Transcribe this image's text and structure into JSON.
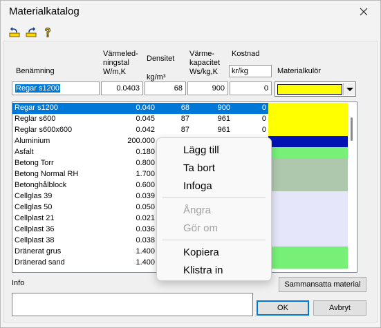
{
  "window": {
    "title": "Materialkatalog"
  },
  "toolbar": {
    "icons": [
      "undo-icon",
      "redo-icon",
      "help-icon"
    ]
  },
  "headers": {
    "name": "Benämning",
    "conductivity": [
      "Värmeled-",
      "ningstal",
      "W/m,K"
    ],
    "density": [
      "Densitet",
      "kg/m³"
    ],
    "heatcap": [
      "Värme-",
      "kapacitet",
      "Ws/kg,K"
    ],
    "cost": [
      "Kostnad",
      "kr/kg"
    ],
    "color": "Materialkulör"
  },
  "edit": {
    "name": "Regar s1200",
    "conductivity": "0.0403",
    "density": "68",
    "heatcap": "900",
    "cost": "0",
    "color": "#ffff00"
  },
  "materials": [
    {
      "name": "Regar s1200",
      "v1": "0.040",
      "v2": "68",
      "v3": "900",
      "v4": "0",
      "color": "#ffff00"
    },
    {
      "name": "Reglar s600",
      "v1": "0.045",
      "v2": "87",
      "v3": "961",
      "v4": "0",
      "color": "#ffff00"
    },
    {
      "name": "Reglar s600x600",
      "v1": "0.042",
      "v2": "87",
      "v3": "961",
      "v4": "0",
      "color": "#ffff00"
    },
    {
      "name": "Aluminium",
      "v1": "200.000",
      "v2": "",
      "v3": "",
      "v4": "",
      "color": "#0014b4"
    },
    {
      "name": "Asfalt",
      "v1": "0.180",
      "v2": "",
      "v3": "",
      "v4": "",
      "color": "#78f078"
    },
    {
      "name": "Betong Torr",
      "v1": "0.800",
      "v2": "",
      "v3": "",
      "v4": "",
      "color": "#aec8ae"
    },
    {
      "name": "Betong Normal RH",
      "v1": "1.700",
      "v2": "",
      "v3": "",
      "v4": "",
      "color": "#aec8ae"
    },
    {
      "name": "Betonghålblock",
      "v1": "0.600",
      "v2": "",
      "v3": "",
      "v4": "",
      "color": "#aec8ae"
    },
    {
      "name": "Cellglas 39",
      "v1": "0.039",
      "v2": "",
      "v3": "",
      "v4": "",
      "color": "#e6e6fa"
    },
    {
      "name": "Cellglas 50",
      "v1": "0.050",
      "v2": "",
      "v3": "",
      "v4": "",
      "color": "#e6e6fa"
    },
    {
      "name": "Cellplast 21",
      "v1": "0.021",
      "v2": "",
      "v3": "",
      "v4": "",
      "color": "#e6e6fa"
    },
    {
      "name": "Cellplast 36",
      "v1": "0.036",
      "v2": "",
      "v3": "",
      "v4": "",
      "color": "#e6e6fa"
    },
    {
      "name": "Cellplast 38",
      "v1": "0.038",
      "v2": "",
      "v3": "",
      "v4": "",
      "color": "#e6e6fa"
    },
    {
      "name": "Dränerat grus",
      "v1": "1.400",
      "v2": "",
      "v3": "",
      "v4": "",
      "color": "#78f078"
    },
    {
      "name": "Dränerad sand",
      "v1": "1.400",
      "v2": "",
      "v3": "",
      "v4": "",
      "color": "#78f078"
    }
  ],
  "info": {
    "label": "Info",
    "value": ""
  },
  "buttons": {
    "composite": "Sammansatta material",
    "ok": "OK",
    "cancel": "Avbryt"
  },
  "context_menu": {
    "items": [
      {
        "label": "Lägg till",
        "enabled": true
      },
      {
        "label": "Ta bort",
        "enabled": true
      },
      {
        "label": "Infoga",
        "enabled": true
      },
      {
        "label": "Ångra",
        "enabled": false
      },
      {
        "label": "Gör om",
        "enabled": false
      },
      {
        "label": "Kopiera",
        "enabled": true
      },
      {
        "label": "Klistra in",
        "enabled": true
      }
    ]
  }
}
